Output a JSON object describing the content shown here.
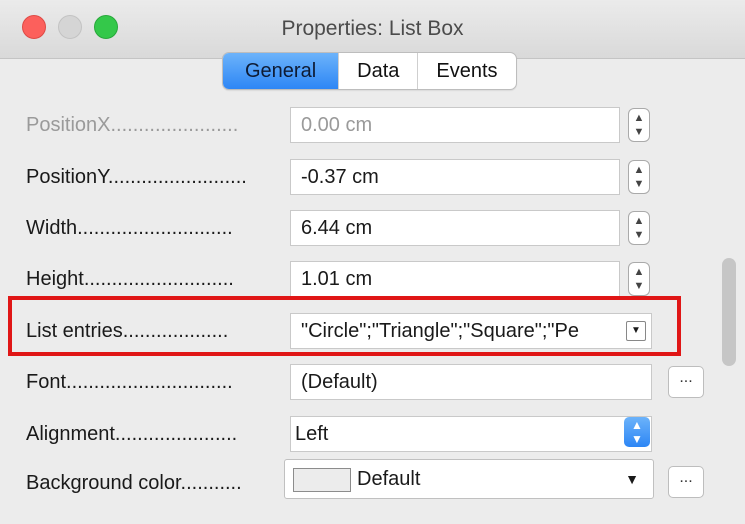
{
  "window": {
    "title": "Properties: List Box"
  },
  "tabs": [
    {
      "label": "General",
      "active": true
    },
    {
      "label": "Data",
      "active": false
    },
    {
      "label": "Events",
      "active": false
    }
  ],
  "rows": {
    "position_x": {
      "label": "PositionX.......................",
      "value": "0.00 cm"
    },
    "position_y": {
      "label": "PositionY.........................",
      "value": "-0.37 cm"
    },
    "width": {
      "label": "Width............................",
      "value": "6.44 cm"
    },
    "height": {
      "label": "Height...........................",
      "value": "1.01 cm"
    },
    "list_entries": {
      "label": "List entries...................",
      "value": "\"Circle\";\"Triangle\";\"Square\";\"Pe"
    },
    "font": {
      "label": "Font..............................",
      "value": "(Default)"
    },
    "alignment": {
      "label": "Alignment......................",
      "value": "Left"
    },
    "background_color": {
      "label": "Background color...........",
      "value": "Default"
    }
  },
  "buttons": {
    "ellipsis": "..."
  },
  "colors": {
    "accent": "#2d86f5",
    "highlight": "#e01616",
    "swatch": "#ececec"
  },
  "icons": [
    "spin-icon",
    "dropdown-arrow-icon",
    "select-chevron-icon"
  ]
}
